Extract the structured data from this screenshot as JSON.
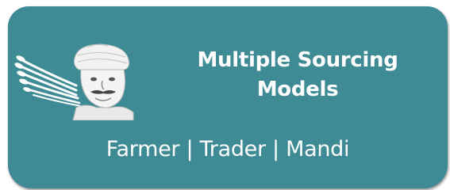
{
  "card": {
    "background_color": "#3e8a95",
    "icon": "farmer-with-turban-and-wheat-icon",
    "title": "Multiple Sourcing Models",
    "subtitle": "Farmer | Trader | Mandi"
  }
}
